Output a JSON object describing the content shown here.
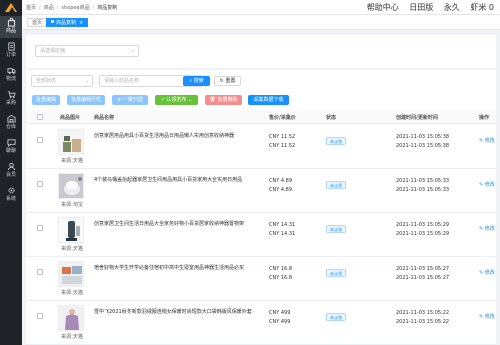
{
  "sidebar": {
    "items": [
      {
        "label": "商品",
        "icon": "bag-icon"
      },
      {
        "label": "订单",
        "icon": "order-icon"
      },
      {
        "label": "物流",
        "icon": "truck-icon"
      },
      {
        "label": "采购",
        "icon": "cart-icon"
      },
      {
        "label": "仓库",
        "icon": "warehouse-icon"
      },
      {
        "label": "聊聊",
        "icon": "chat-icon"
      },
      {
        "label": "会员",
        "icon": "member-icon"
      },
      {
        "label": "系统",
        "icon": "gear-icon"
      }
    ]
  },
  "header": {
    "breadcrumb": [
      "首页",
      "商品",
      "shopee商品",
      "商品复制"
    ],
    "links": [
      "帮助中心",
      "日田版",
      "永久",
      "虾米 0"
    ]
  },
  "tabs": [
    {
      "label": "首页"
    },
    {
      "label": "商品复制"
    }
  ],
  "filters": {
    "shop_select_placeholder": "请选择店铺",
    "status_select": "全部状态",
    "keyword_placeholder": "请输入商品名称",
    "search_label": "搜索",
    "reset_label": "重置"
  },
  "actions": {
    "batch_edit": "批量编辑",
    "batch_edit_row": "批量编辑行性",
    "one_click_publish": "一键刊登",
    "auto_publish": "认领发布",
    "batch_delete": "批量删除",
    "collect_download": "采集数据下载"
  },
  "table": {
    "headers": [
      "商品图片",
      "商品名称",
      "售价/采集价",
      "状态",
      "创建时间/更新时间",
      "操作"
    ],
    "rows": [
      {
        "name": "创意家居用品用具小百货生活用品日用品懒人实用创意收纳神器",
        "prices": [
          "CNY 11.52",
          "CNY 11.52"
        ],
        "status": "未认领",
        "times": [
          "2021-11-03 15:05:38",
          "2021-11-03 15:05:38"
        ],
        "source": "来源:天猫",
        "edit": "修改"
      },
      {
        "name": "4个装马桶盖抬起器家居卫生间用品用具小百货家用大全实用日用品",
        "prices": [
          "CNY 4.89",
          "CNY 4.89"
        ],
        "status": "未认领",
        "times": [
          "2021-11-03 15:05:33",
          "2021-11-03 15:05:33"
        ],
        "source": "来源:淘宝",
        "edit": "修改"
      },
      {
        "name": "创意家居卫生间生活日用品大全家务好物小百货居家收纳神器置物架",
        "prices": [
          "CNY 14.31",
          "CNY 14.31"
        ],
        "status": "未认领",
        "times": [
          "2021-11-03 15:05:29",
          "2021-11-03 15:05:29"
        ],
        "source": "来源:天猫",
        "edit": "修改"
      },
      {
        "name": "宿舍好物大学生开学必备住宿初中高中生寝室用品神器生活用品必买",
        "prices": [
          "CNY 16.8",
          "CNY 16.8"
        ],
        "status": "未认领",
        "times": [
          "2021-11-03 15:05:27",
          "2021-11-03 15:05:27"
        ],
        "source": "来源:天猫",
        "edit": "修改"
      },
      {
        "name": "雪中飞2021秋冬新款羽绒服连帽女保暖时尚短款大口袋韩版风保暖外套",
        "prices": [
          "CNY 499",
          "CNY 499"
        ],
        "status": "未认领",
        "times": [
          "2021-11-03 15:05:22",
          "2021-11-03 15:05:22"
        ],
        "source": "来源:天猫",
        "edit": "修改"
      }
    ]
  },
  "colors": {
    "sidebar_bg": "#1f2329",
    "primary": "#1890ff",
    "success": "#67c23a",
    "danger": "#f38e8e"
  }
}
